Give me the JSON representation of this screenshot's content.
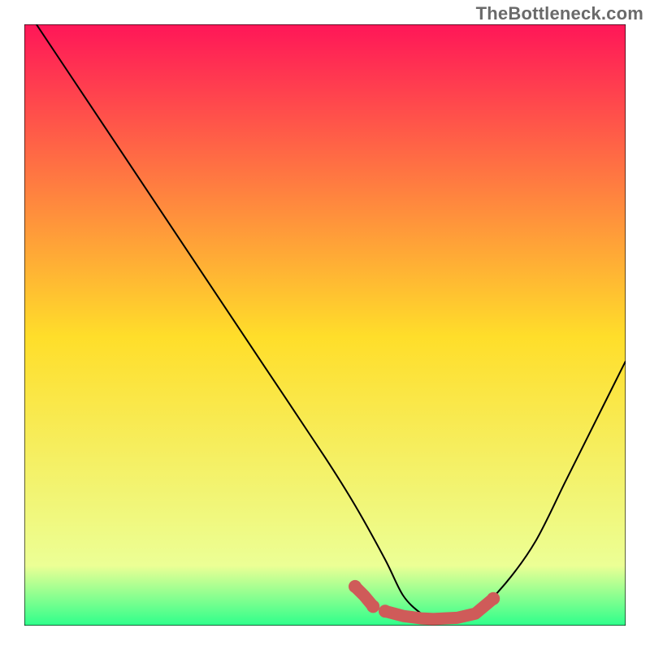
{
  "watermark": "TheBottleneck.com",
  "colors": {
    "curve": "#000000",
    "highlight": "#cf5b59",
    "grad_top": "#ff1658",
    "grad_mid": "#ffde2a",
    "grad_bot_upper": "#ecff95",
    "grad_bot": "#2eff8b",
    "border": "#000000"
  },
  "chart_data": {
    "type": "line",
    "title": "",
    "xlabel": "",
    "ylabel": "",
    "xlim": [
      0,
      100
    ],
    "ylim": [
      0,
      100
    ],
    "series": [
      {
        "name": "bottleneck-curve",
        "x": [
          2,
          10,
          20,
          30,
          40,
          50,
          55,
          60,
          63,
          66,
          68,
          72,
          75,
          80,
          85,
          90,
          95,
          100
        ],
        "y": [
          100,
          88,
          73,
          58,
          43,
          28,
          20,
          11,
          5,
          2,
          1,
          1,
          2,
          7,
          14,
          24,
          34,
          44
        ]
      }
    ],
    "highlight_segments": [
      {
        "x": [
          55,
          56.5,
          58
        ],
        "y": [
          6.5,
          5,
          3.2
        ]
      },
      {
        "x": [
          60,
          63,
          66,
          68,
          72,
          75,
          78
        ],
        "y": [
          2.4,
          1.6,
          1.2,
          1.1,
          1.3,
          2.0,
          4.5
        ]
      }
    ]
  }
}
